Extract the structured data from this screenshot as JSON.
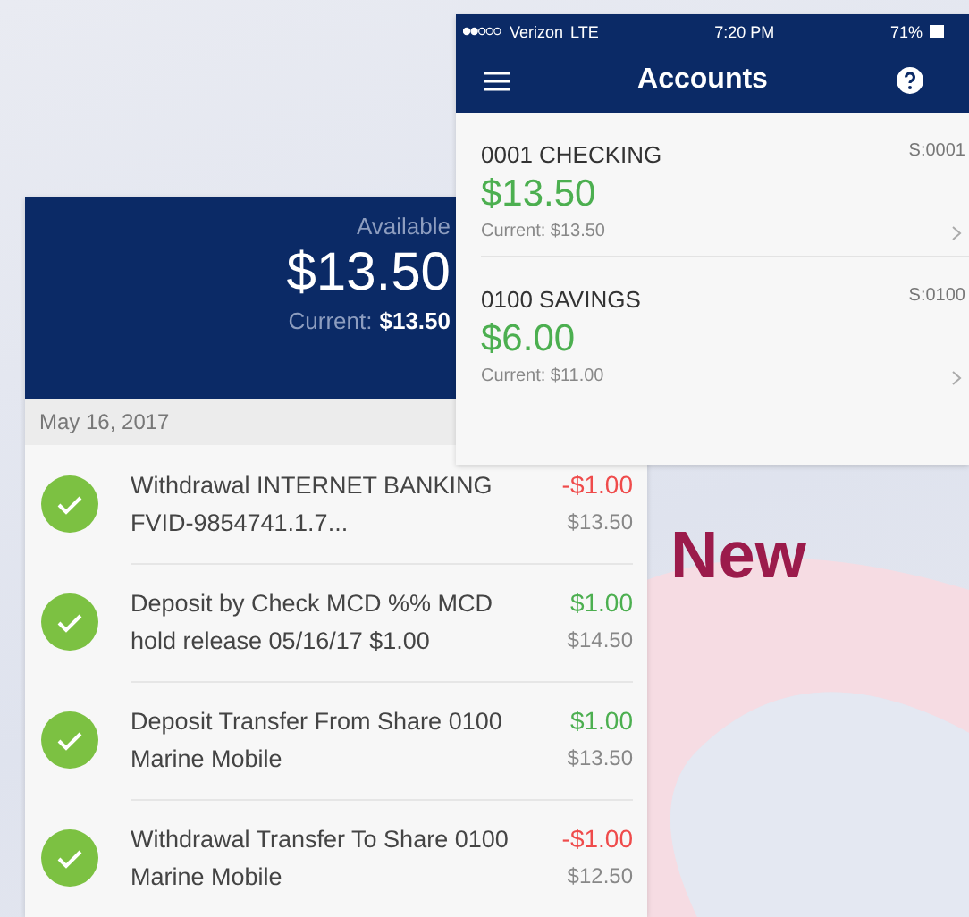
{
  "accounts_screen": {
    "status_bar": {
      "carrier": "Verizon",
      "network": "LTE",
      "time": "7:20 PM",
      "battery": "71%"
    },
    "title": "Accounts",
    "accounts": [
      {
        "name": "0001 CHECKING",
        "amount": "$13.50",
        "current": "Current: $13.50",
        "code": "S:0001"
      },
      {
        "name": "0100 SAVINGS",
        "amount": "$6.00",
        "current": "Current: $11.00",
        "code": "S:0100"
      }
    ]
  },
  "account_screen": {
    "available_label": "Available",
    "available": "$13.50",
    "current_label": "Current:",
    "current": "$13.50",
    "date": "May 16, 2017",
    "transactions": [
      {
        "description": "Withdrawal INTERNET BANKING FVID-9854741.1.7...",
        "amount": "-$1.00",
        "kind": "debit",
        "balance": "$13.50",
        "cleared": true
      },
      {
        "description": "Deposit by Check MCD %% MCD hold release 05/16/17 $1.00",
        "amount": "$1.00",
        "kind": "credit",
        "balance": "$14.50",
        "cleared": true
      },
      {
        "description": "Deposit Transfer From Share 0100 Marine Mobile",
        "amount": "$1.00",
        "kind": "credit",
        "balance": "$13.50",
        "cleared": true
      },
      {
        "description": "Withdrawal Transfer To Share 0100 Marine Mobile",
        "amount": "-$1.00",
        "kind": "debit",
        "balance": "$12.50",
        "cleared": true
      }
    ]
  },
  "headline": "New"
}
